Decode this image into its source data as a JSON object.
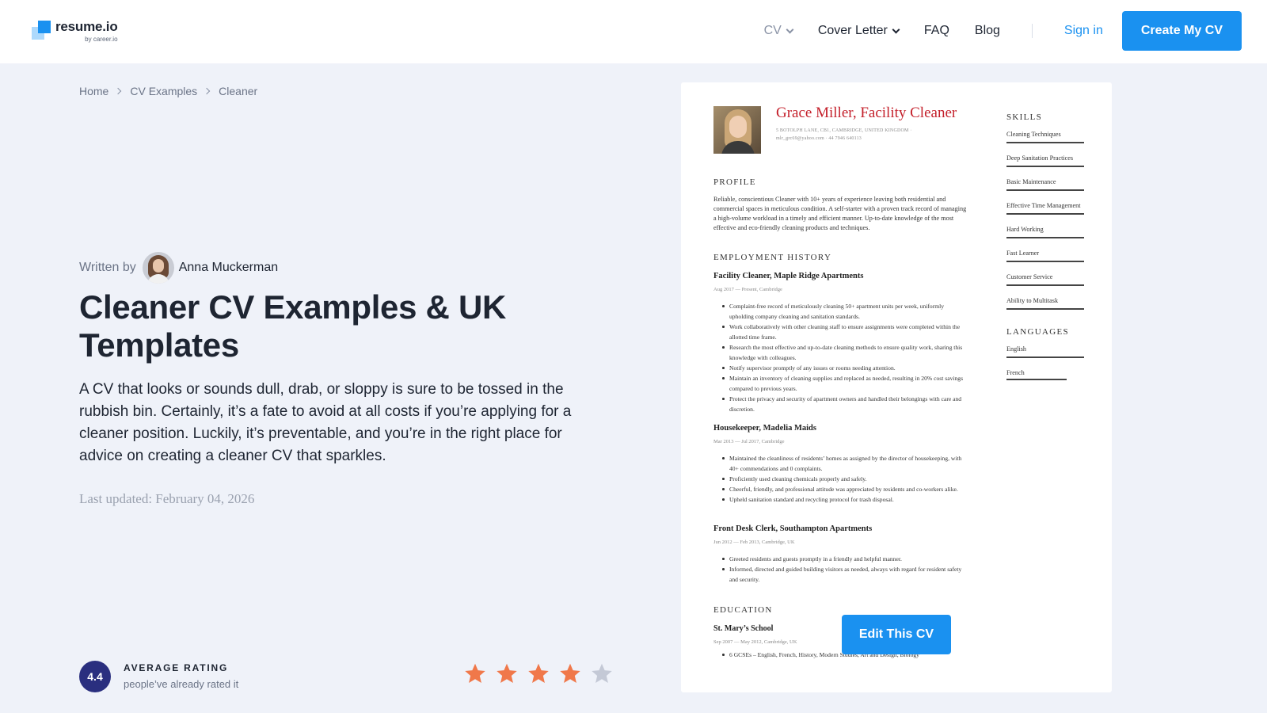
{
  "header": {
    "logo_name": "resume.io",
    "logo_sub": "by career.io",
    "nav": [
      {
        "label": "CV",
        "icon": "chevron-down-icon"
      },
      {
        "label": "Cover Letter",
        "icon": "chevron-down-icon"
      },
      {
        "label": "FAQ"
      },
      {
        "label": "Blog"
      }
    ],
    "sign_in": "Sign in",
    "cta": "Create My CV",
    "accent_color": "#1a91f0"
  },
  "breadcrumb": [
    "Home",
    "CV Examples",
    "Cleaner"
  ],
  "author": {
    "written_by": "Written by",
    "name": "Anna Muckerman"
  },
  "title": "Cleaner CV Examples & UK Templates",
  "intro": "A CV that looks or sounds dull, drab, or sloppy is sure to be tossed in the rubbish bin. Certainly, it’s a fate to avoid at all costs if you’re applying for a cleaner position. Luckily, it’s preventable, and you’re in the right place for advice on creating a cleaner CV that sparkles.",
  "last_updated": "Last updated: February 04, 2026",
  "rating": {
    "value": "4.4",
    "title": "AVERAGE RATING",
    "subtitle": "people’ve already rated it",
    "stars_filled": 4,
    "stars_total": 5,
    "star_color": "#f0784a",
    "star_empty_color": "#c4c9d6"
  },
  "cv": {
    "name": "Grace Miller, Facility Cleaner",
    "contact_1": "5 BOTOLPH LANE, CB1, CAMBRIDGE, UNITED KINGDOM ·",
    "contact_2": "mlr_grc69@yahoo.com · 44 7946 640113",
    "profile_heading": "PROFILE",
    "profile": "Reliable, conscientious Cleaner with 10+ years of experience leaving both residential and commercial spaces in meticulous condition. A self-starter with a proven track record of managing a high-volume workload in a timely and efficient manner. Up-to-date knowledge of the most effective and eco-friendly cleaning products and techniques.",
    "employment_heading": "EMPLOYMENT HISTORY",
    "jobs": [
      {
        "role": "Facility Cleaner, Maple Ridge Apartments",
        "date": "Aug 2017 — Present, Cambridge",
        "bullets": [
          "Complaint-free record of meticulously cleaning 50+ apartment units per week, uniformly upholding company cleaning and sanitation standards.",
          "Work collaboratively with other cleaning staff to ensure assignments were completed within the allotted time frame.",
          "Research the most effective and up-to-date cleaning methods to ensure quality work, sharing this knowledge with colleagues.",
          "Notify supervisor promptly of any issues or rooms needing attention.",
          "Maintain an inventory of cleaning supplies and replaced as needed, resulting in 20% cost savings compared to previous years.",
          "Protect the privacy and security of apartment owners and handled their belongings with care and discretion."
        ]
      },
      {
        "role": "Housekeeper, Madelia Maids",
        "date": "Mar 2013 — Jul 2017, Cambridge",
        "bullets": [
          "Maintained the cleanliness of residents’ homes as assigned by the director of housekeeping, with 40+ commendations and 0 complaints.",
          "Proficiently used cleaning chemicals properly and safely.",
          "Cheerful, friendly, and professional attitude was appreciated by residents and co-workers alike.",
          "Upheld sanitation standard and recycling protocol for trash disposal."
        ]
      },
      {
        "role": "Front Desk Clerk, Southampton Apartments",
        "date": "Jun 2012 — Feb 2013, Cambridge, UK",
        "bullets": [
          "Greeted residents and guests promptly in a friendly and helpful manner.",
          "Informed, directed and guided building visitors as needed, always with regard for resident safety and security."
        ]
      }
    ],
    "education_heading": "EDUCATION",
    "school": "St. Mary’s School",
    "school_date": "Sep 2007 — May 2012, Cambridge, UK",
    "school_bullet": "6 GCSEs – English, French, History, Modern Studies, Art and Design, Biology",
    "skills_heading": "SKILLS",
    "skills": [
      "Cleaning Techniques",
      "Deep Sanitation Practices",
      "Basic Maintenance",
      "Effective Time Management",
      "Hard Working",
      "Fast Learner",
      "Customer Service",
      "Ability to Multitask"
    ],
    "languages_heading": "LANGUAGES",
    "languages": [
      "English",
      "French"
    ],
    "edit_button": "Edit This CV"
  }
}
